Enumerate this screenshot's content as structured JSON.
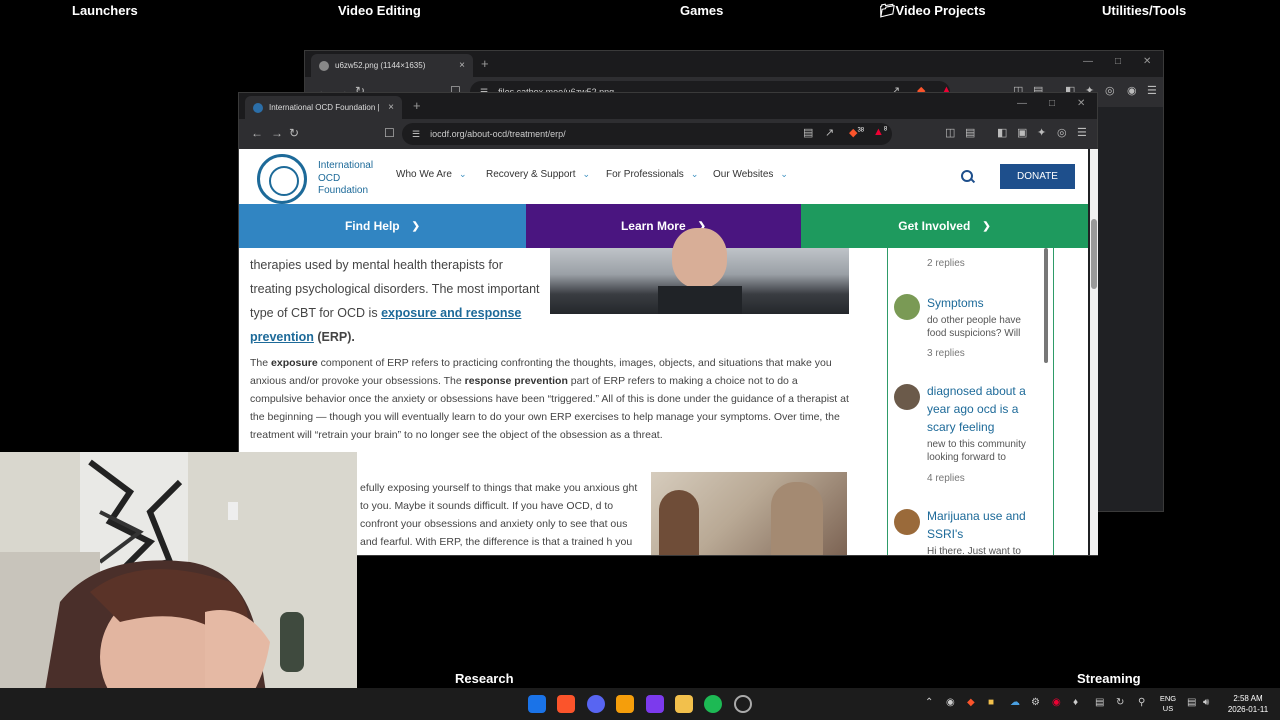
{
  "desktop": {
    "labels": [
      "Launchers",
      "Video Editing",
      "Games",
      "Video Projects",
      "Utilities/Tools",
      "Research",
      "Streaming"
    ]
  },
  "back_window": {
    "tab_title": "u6zw52.png (1144×1635)",
    "url": "files.catbox.moe/u6zw52.png",
    "tab_close": "×",
    "new_tab": "+"
  },
  "front_window": {
    "tab_title": "International OCD Foundation | E",
    "tab_close": "×",
    "new_tab": "+",
    "url": "iocdf.org/about-ocd/treatment/erp/",
    "shield_badge": "38",
    "alert_badge": "8"
  },
  "site": {
    "logo_text": "International OCD Foundation",
    "nav": [
      "Who We Are",
      "Recovery & Support",
      "For Professionals",
      "Our Websites"
    ],
    "donate": "DONATE",
    "bands": [
      {
        "label": "Find Help",
        "color": "#3185c2"
      },
      {
        "label": "Learn More",
        "color": "#4a1580"
      },
      {
        "label": "Get Involved",
        "color": "#1e9a5e"
      }
    ]
  },
  "article": {
    "lead_before": "therapies used by mental health therapists for treating psychological disorders. The most important type of CBT for OCD is ",
    "lead_link": "exposure and response prevention",
    "lead_after": " (ERP).",
    "para1": {
      "t1": "The ",
      "b1": "exposure",
      "t2": " component of ERP refers to practicing confronting the thoughts, images, objects, and situations that make you anxious and/or provoke your obsessions. The ",
      "b2": "response prevention",
      "t3": " part of ERP refers to making a choice not to do a compulsive behavior once the anxiety or obsessions have been “triggered.” All of this is done under the guidance of a therapist at the beginning — though you will eventually learn to do your own ERP exercises to help manage your symptoms. Over time, the treatment will “retrain your brain” to no longer see the object of the obsession as a threat."
    },
    "para2": "efully exposing yourself to things that make you anxious ght to you. Maybe it sounds difficult. If you have OCD, d to confront your obsessions and anxiety only to see that ous and fearful. With ERP, the difference is that a trained h you to develop a plan for exposure. Then, that therapist"
  },
  "community": [
    {
      "title": "",
      "snippet": "",
      "replies": "2 replies",
      "avatar_color": "#8a8f7a"
    },
    {
      "title": "Symptoms",
      "snippet": "do other people have food suspicions? Will",
      "replies": "3 replies",
      "avatar_color": "#7a9a55"
    },
    {
      "title": "diagnosed about a year ago ocd is a scary feeling",
      "snippet": "new to this community looking forward to",
      "replies": "4 replies",
      "avatar_color": "#6b5a4a"
    },
    {
      "title": "Marijuana use and SSRI's",
      "snippet": "Hi there. Just want to",
      "replies": "",
      "avatar_color": "#9a6a3a"
    }
  ],
  "taskbar": {
    "apps": [
      "start",
      "brave",
      "discord",
      "media",
      "obsidian",
      "files",
      "spotify",
      "settings"
    ],
    "lang_top": "ENG",
    "lang_bottom": "US",
    "time": "2:58 AM",
    "date": "2026-01-11"
  }
}
